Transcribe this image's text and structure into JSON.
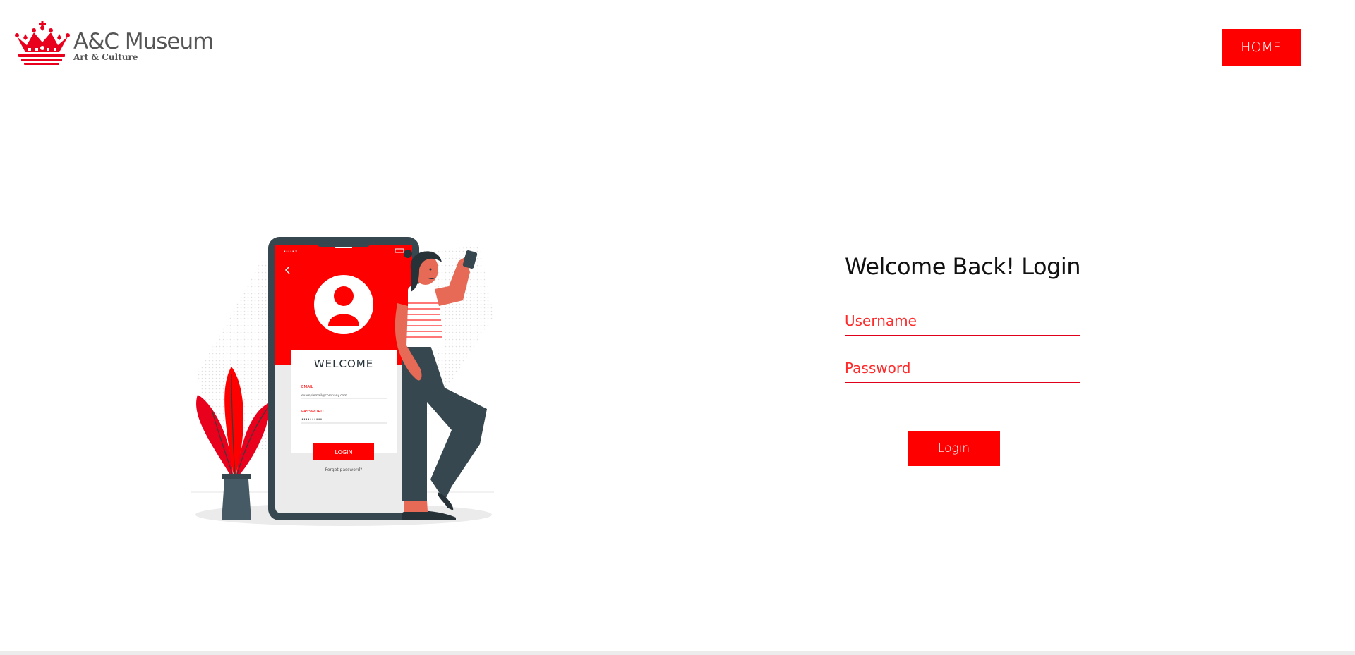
{
  "brand": {
    "title": "A&C Museum",
    "subtitle": "Art & Culture",
    "logo_icon": "crown-icon",
    "accent_color": "#ff0000"
  },
  "nav": {
    "home_label": "HOME"
  },
  "illustration": {
    "phone_welcome": "WELCOME",
    "phone_email_label": "EMAIL",
    "phone_email_value": "examplemail@company.com",
    "phone_password_label": "PASSWORD",
    "phone_login_label": "LOGIN",
    "phone_forgot_label": "Forgot password?"
  },
  "login": {
    "title": "Welcome Back! Login",
    "username_placeholder": "Username",
    "password_placeholder": "Password",
    "submit_label": "Login"
  }
}
